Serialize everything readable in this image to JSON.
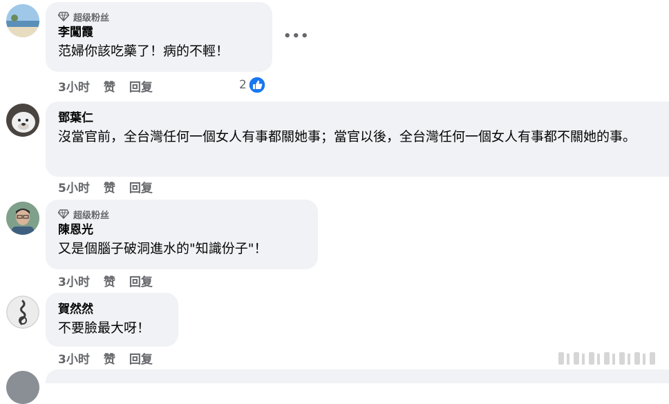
{
  "super_fan_badge": "超级粉丝",
  "more_icon": "more-horizontal-icon",
  "like_reaction_icon": "like-thumb-icon",
  "colors": {
    "bubble_bg": "#f0f2f5",
    "meta_text": "#65676b",
    "like_blue": "#1877f2"
  },
  "comments": [
    {
      "author": "李闖霞",
      "text": "范婦你該吃藥了！病的不輕！",
      "time": "3小时",
      "like_label": "赞",
      "reply_label": "回复",
      "reaction_count": "2"
    },
    {
      "author": "鄧葉仁",
      "text": "沒當官前，全台灣任何一個女人有事都關她事；當官以後，全台灣任何一個女人有事都不關她的事。",
      "time": "5小时",
      "like_label": "赞",
      "reply_label": "回复"
    },
    {
      "author": "陳恩光",
      "text": "又是個腦子破洞進水的\"知識份子\"！",
      "time": "3小时",
      "like_label": "赞",
      "reply_label": "回复"
    },
    {
      "author": "賀然然",
      "text": "不要臉最大呀！",
      "time": "3小时",
      "like_label": "赞",
      "reply_label": "回复"
    }
  ]
}
